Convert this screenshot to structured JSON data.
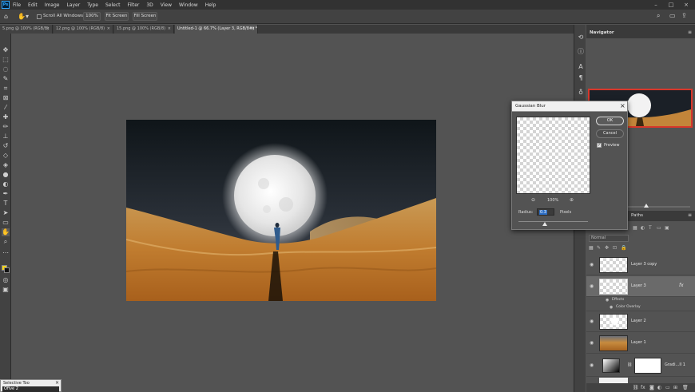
{
  "menubar": {
    "items": [
      "File",
      "Edit",
      "Image",
      "Layer",
      "Type",
      "Select",
      "Filter",
      "3D",
      "View",
      "Window",
      "Help"
    ],
    "app_icon": "Ps"
  },
  "options_bar": {
    "scroll_all_windows": "Scroll All Windows",
    "zoom_100": "100%",
    "fit_screen": "Fit Screen",
    "fill_screen": "Fill Screen"
  },
  "tabs": [
    {
      "label": "5.png @ 100% (RGB/8)",
      "close": "×",
      "active": false
    },
    {
      "label": "12.png @ 100% (RGB/8)",
      "close": "×",
      "active": false
    },
    {
      "label": "15.png @ 100% (RGB/8)",
      "close": "×",
      "active": false
    },
    {
      "label": "Untitled-1 @ 66.7% (Layer 3, RGB/8#) *",
      "close": "×",
      "active": true
    }
  ],
  "navigator": {
    "title": "Navigator"
  },
  "layers_panel": {
    "tab_paths": "Paths",
    "blend_mode": "Normal",
    "layers": [
      {
        "name": "Layer 3 copy",
        "selected": false,
        "thumb": "transparent"
      },
      {
        "name": "Layer 3",
        "selected": true,
        "thumb": "transparent",
        "fx": "fx"
      },
      {
        "name": "Layer 2",
        "selected": false,
        "thumb": "moon"
      },
      {
        "name": "Layer 1",
        "selected": false,
        "thumb": "desert"
      },
      {
        "name": "Gradi...ll 1",
        "selected": false,
        "thumb": "gradient"
      }
    ],
    "effects_label": "Effects",
    "color_overlay_label": "Color Overlay"
  },
  "dialog": {
    "title": "Gaussian Blur",
    "ok_label": "OK",
    "cancel_label": "Cancel",
    "preview_label": "Preview",
    "preview_checked": true,
    "zoom_level": "100%",
    "radius_label": "Radius:",
    "radius_value": "0.3",
    "radius_unit": "Pixels",
    "slider_fraction": 0.38
  },
  "mini_panel": {
    "line1": "Selective Too",
    "line2": "Ofive 2"
  },
  "colors": {
    "menubar": "#323232",
    "panel": "#424242",
    "workspace": "#535353",
    "accent": "#31a8ff",
    "foreground_swatch": "#f5d51a",
    "background_swatch": "#111111",
    "navigator_frame": "#d9372b"
  }
}
